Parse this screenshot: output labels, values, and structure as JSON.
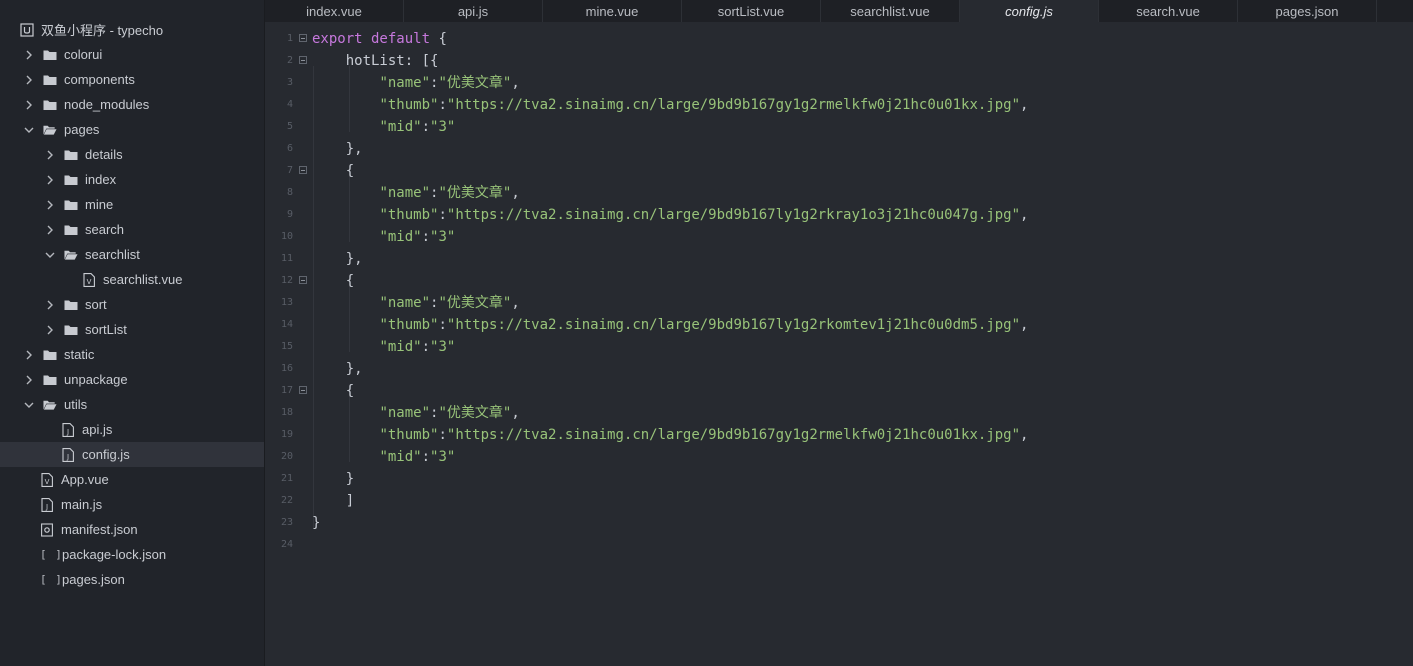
{
  "project_title": "双鱼小程序 - typecho",
  "tree": [
    {
      "label": "colorui",
      "kind": "folder",
      "open": false
    },
    {
      "label": "components",
      "kind": "folder",
      "open": false
    },
    {
      "label": "node_modules",
      "kind": "folder",
      "open": false
    },
    {
      "label": "pages",
      "kind": "folder",
      "open": true
    },
    {
      "label": "details",
      "kind": "folder",
      "open": false
    },
    {
      "label": "index",
      "kind": "folder",
      "open": false
    },
    {
      "label": "mine",
      "kind": "folder",
      "open": false
    },
    {
      "label": "search",
      "kind": "folder",
      "open": false
    },
    {
      "label": "searchlist",
      "kind": "folder",
      "open": true
    },
    {
      "label": "searchlist.vue",
      "kind": "vue"
    },
    {
      "label": "sort",
      "kind": "folder",
      "open": false
    },
    {
      "label": "sortList",
      "kind": "folder",
      "open": false
    },
    {
      "label": "static",
      "kind": "folder",
      "open": false
    },
    {
      "label": "unpackage",
      "kind": "folder",
      "open": false
    },
    {
      "label": "utils",
      "kind": "folder",
      "open": true
    },
    {
      "label": "api.js",
      "kind": "js"
    },
    {
      "label": "config.js",
      "kind": "js",
      "active": true
    },
    {
      "label": "App.vue",
      "kind": "vue"
    },
    {
      "label": "main.js",
      "kind": "js"
    },
    {
      "label": "manifest.json",
      "kind": "manifest"
    },
    {
      "label": "package-lock.json",
      "kind": "json"
    },
    {
      "label": "pages.json",
      "kind": "json"
    }
  ],
  "tabs": [
    "index.vue",
    "api.js",
    "mine.vue",
    "sortList.vue",
    "searchlist.vue",
    "config.js",
    "search.vue",
    "pages.json"
  ],
  "active_tab": "config.js",
  "code_lines": [
    {
      "n": "1",
      "fold": true,
      "parts": [
        [
          "kw",
          "export default"
        ],
        [
          "plain",
          " {"
        ]
      ]
    },
    {
      "n": "2",
      "fold": true,
      "parts": [
        [
          "plain",
          "    hotList: [{"
        ]
      ]
    },
    {
      "n": "3",
      "parts": [
        [
          "plain",
          "        "
        ],
        [
          "str",
          "\"name\""
        ],
        [
          "plain",
          ":"
        ],
        [
          "str",
          "\"优美文章\""
        ],
        [
          "plain",
          ","
        ]
      ]
    },
    {
      "n": "4",
      "parts": [
        [
          "plain",
          "        "
        ],
        [
          "str",
          "\"thumb\""
        ],
        [
          "plain",
          ":"
        ],
        [
          "str",
          "\"https://tva2.sinaimg.cn/large/9bd9b167gy1g2rmelkfw0j21hc0u01kx.jpg\""
        ],
        [
          "plain",
          ","
        ]
      ]
    },
    {
      "n": "5",
      "parts": [
        [
          "plain",
          "        "
        ],
        [
          "str",
          "\"mid\""
        ],
        [
          "plain",
          ":"
        ],
        [
          "str",
          "\"3\""
        ]
      ]
    },
    {
      "n": "6",
      "parts": [
        [
          "plain",
          "    },"
        ]
      ]
    },
    {
      "n": "7",
      "fold": true,
      "parts": [
        [
          "plain",
          "    {"
        ]
      ]
    },
    {
      "n": "8",
      "parts": [
        [
          "plain",
          "        "
        ],
        [
          "str",
          "\"name\""
        ],
        [
          "plain",
          ":"
        ],
        [
          "str",
          "\"优美文章\""
        ],
        [
          "plain",
          ","
        ]
      ]
    },
    {
      "n": "9",
      "parts": [
        [
          "plain",
          "        "
        ],
        [
          "str",
          "\"thumb\""
        ],
        [
          "plain",
          ":"
        ],
        [
          "str",
          "\"https://tva2.sinaimg.cn/large/9bd9b167ly1g2rkray1o3j21hc0u047g.jpg\""
        ],
        [
          "plain",
          ","
        ]
      ]
    },
    {
      "n": "10",
      "parts": [
        [
          "plain",
          "        "
        ],
        [
          "str",
          "\"mid\""
        ],
        [
          "plain",
          ":"
        ],
        [
          "str",
          "\"3\""
        ]
      ]
    },
    {
      "n": "11",
      "parts": [
        [
          "plain",
          "    },"
        ]
      ]
    },
    {
      "n": "12",
      "fold": true,
      "parts": [
        [
          "plain",
          "    {"
        ]
      ]
    },
    {
      "n": "13",
      "parts": [
        [
          "plain",
          "        "
        ],
        [
          "str",
          "\"name\""
        ],
        [
          "plain",
          ":"
        ],
        [
          "str",
          "\"优美文章\""
        ],
        [
          "plain",
          ","
        ]
      ]
    },
    {
      "n": "14",
      "parts": [
        [
          "plain",
          "        "
        ],
        [
          "str",
          "\"thumb\""
        ],
        [
          "plain",
          ":"
        ],
        [
          "str",
          "\"https://tva2.sinaimg.cn/large/9bd9b167ly1g2rkomtev1j21hc0u0dm5.jpg\""
        ],
        [
          "plain",
          ","
        ]
      ]
    },
    {
      "n": "15",
      "parts": [
        [
          "plain",
          "        "
        ],
        [
          "str",
          "\"mid\""
        ],
        [
          "plain",
          ":"
        ],
        [
          "str",
          "\"3\""
        ]
      ]
    },
    {
      "n": "16",
      "parts": [
        [
          "plain",
          "    },"
        ]
      ]
    },
    {
      "n": "17",
      "fold": true,
      "parts": [
        [
          "plain",
          "    {"
        ]
      ]
    },
    {
      "n": "18",
      "parts": [
        [
          "plain",
          "        "
        ],
        [
          "str",
          "\"name\""
        ],
        [
          "plain",
          ":"
        ],
        [
          "str",
          "\"优美文章\""
        ],
        [
          "plain",
          ","
        ]
      ]
    },
    {
      "n": "19",
      "parts": [
        [
          "plain",
          "        "
        ],
        [
          "str",
          "\"thumb\""
        ],
        [
          "plain",
          ":"
        ],
        [
          "str",
          "\"https://tva2.sinaimg.cn/large/9bd9b167gy1g2rmelkfw0j21hc0u01kx.jpg\""
        ],
        [
          "plain",
          ","
        ]
      ]
    },
    {
      "n": "20",
      "parts": [
        [
          "plain",
          "        "
        ],
        [
          "str",
          "\"mid\""
        ],
        [
          "plain",
          ":"
        ],
        [
          "str",
          "\"3\""
        ]
      ]
    },
    {
      "n": "21",
      "parts": [
        [
          "plain",
          "    }"
        ]
      ]
    },
    {
      "n": "22",
      "parts": [
        [
          "plain",
          "    ]"
        ]
      ]
    },
    {
      "n": "23",
      "parts": [
        [
          "plain",
          "}"
        ]
      ]
    },
    {
      "n": "24",
      "parts": []
    }
  ],
  "colors": {
    "keyword": "#c678dd",
    "string": "#98c379",
    "text": "#c8ccd4",
    "sidebar_bg": "#21242a",
    "editor_bg": "#272a30"
  }
}
